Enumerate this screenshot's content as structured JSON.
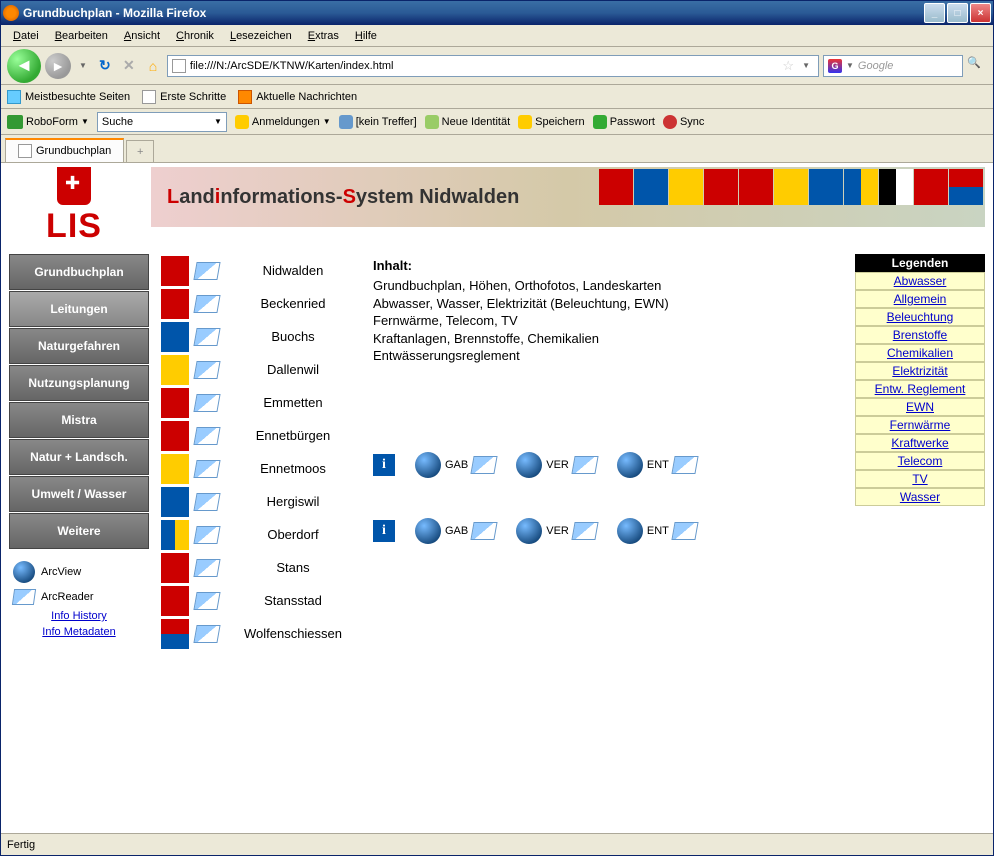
{
  "window": {
    "title": "Grundbuchplan - Mozilla Firefox"
  },
  "menu": {
    "items": [
      "Datei",
      "Bearbeiten",
      "Ansicht",
      "Chronik",
      "Lesezeichen",
      "Extras",
      "Hilfe"
    ]
  },
  "url": "file:///N:/ArcSDE/KTNW/Karten/index.html",
  "search_placeholder": "Google",
  "bookmarks": [
    {
      "label": "Meistbesuchte Seiten"
    },
    {
      "label": "Erste Schritte"
    },
    {
      "label": "Aktuelle Nachrichten"
    }
  ],
  "roboform": {
    "brand": "RoboForm",
    "select": "Suche",
    "items": [
      "Anmeldungen",
      "[kein Treffer]",
      "Neue Identität",
      "Speichern",
      "Passwort",
      "Sync"
    ]
  },
  "tab": {
    "title": "Grundbuchplan"
  },
  "banner": {
    "lis": "LIS",
    "prefix_L": "L",
    "mid1": "and",
    "i": "i",
    "mid2": "nformations-",
    "S": "S",
    "mid3": "ystem Nidwalden"
  },
  "sidebar": {
    "buttons": [
      "Grundbuchplan",
      "Leitungen",
      "Naturgefahren",
      "Nutzungsplanung",
      "Mistra",
      "Natur + Landsch.",
      "Umwelt / Wasser",
      "Weitere"
    ],
    "active_index": 1,
    "arcview": "ArcView",
    "arcreader": "ArcReader",
    "links": [
      "Info History",
      "Info Metadaten"
    ]
  },
  "municipalities": [
    "Nidwalden",
    "Beckenried",
    "Buochs",
    "Dallenwil",
    "Emmetten",
    "Ennetbürgen",
    "Ennetmoos",
    "Hergiswil",
    "Oberdorf",
    "Stans",
    "Stansstad",
    "Wolfenschiessen"
  ],
  "inhalt": {
    "title": "Inhalt:",
    "lines": [
      "Grundbuchplan, Höhen, Orthofotos, Landeskarten",
      "Abwasser, Wasser, Elektrizität (Beleuchtung, EWN)",
      "Fernwärme, Telecom, TV",
      "Kraftanlagen, Brennstoffe, Chemikalien",
      "Entwässerungsreglement"
    ]
  },
  "link_labels": {
    "gab": "GAB",
    "ver": "VER",
    "ent": "ENT"
  },
  "legend": {
    "header": "Legenden",
    "items": [
      "Abwasser",
      "Allgemein",
      "Beleuchtung",
      "Brenstoffe",
      "Chemikalien",
      "Elektrizität",
      "Entw. Reglement",
      "EWN",
      "Fernwärme",
      "Kraftwerke",
      "Telecom",
      "TV",
      "Wasser"
    ]
  },
  "status": "Fertig"
}
